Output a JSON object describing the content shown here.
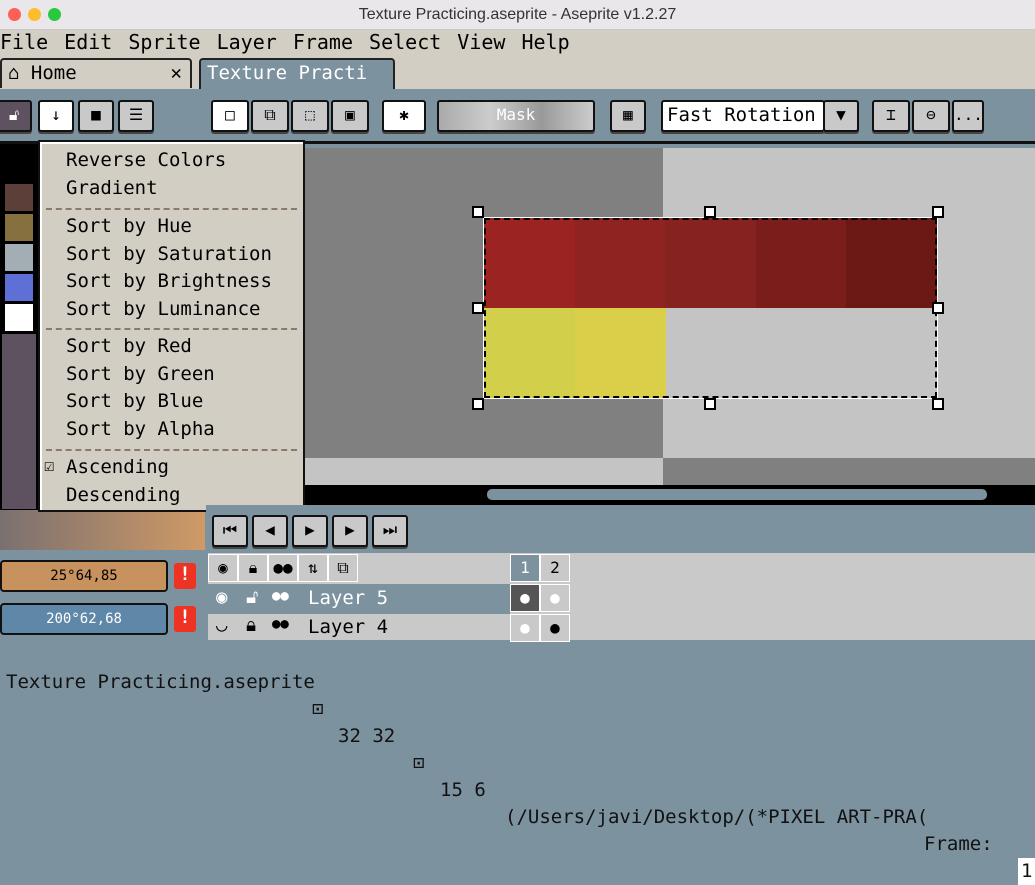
{
  "window": {
    "title": "Texture Practicing.aseprite - Aseprite v1.2.27"
  },
  "menubar": [
    "File",
    "Edit",
    "Sprite",
    "Layer",
    "Frame",
    "Select",
    "View",
    "Help"
  ],
  "tabs": [
    {
      "label": "Home",
      "icon": "home-icon",
      "close": "✕"
    },
    {
      "label": "Texture Practi",
      "modified": "●"
    }
  ],
  "toolbar": {
    "mask_label": "Mask",
    "rotation_algorithm": "Fast Rotation",
    "more_label": "..."
  },
  "context_menu": {
    "items": [
      "Reverse Colors",
      "Gradient",
      "Sort by Hue",
      "Sort by Saturation",
      "Sort by Brightness",
      "Sort by Luminance",
      "Sort by Red",
      "Sort by Green",
      "Sort by Blue",
      "Sort by Alpha",
      "Ascending",
      "Descending"
    ],
    "checked": "Ascending"
  },
  "palette": {
    "colors": [
      "#5b3f38",
      "#86703f",
      "#a3aeb4",
      "#5e6fd6",
      "#ffffff"
    ]
  },
  "colors": {
    "fg_value": "25°64,85",
    "bg_value": "200°62,68",
    "fg": "#c8925f",
    "bg": "#5f87a8"
  },
  "sprite": {
    "top_row": [
      "#9b2422",
      "#8f2321",
      "#862220",
      "#7a1d1b",
      "#6c1815"
    ],
    "bottom_row": [
      "#d2d04b",
      "#dbcf4a"
    ]
  },
  "timeline": {
    "frames": [
      "1",
      "2"
    ],
    "layers": [
      {
        "name": "Layer 5"
      },
      {
        "name": "Layer 4"
      }
    ]
  },
  "status": {
    "filename": "Texture Practicing.aseprite",
    "size": "32 32",
    "pos": "15 6",
    "path": "(/Users/javi/Desktop/(*PIXEL ART-PRA(",
    "frame_label": "Frame:",
    "frame_value": "1"
  }
}
